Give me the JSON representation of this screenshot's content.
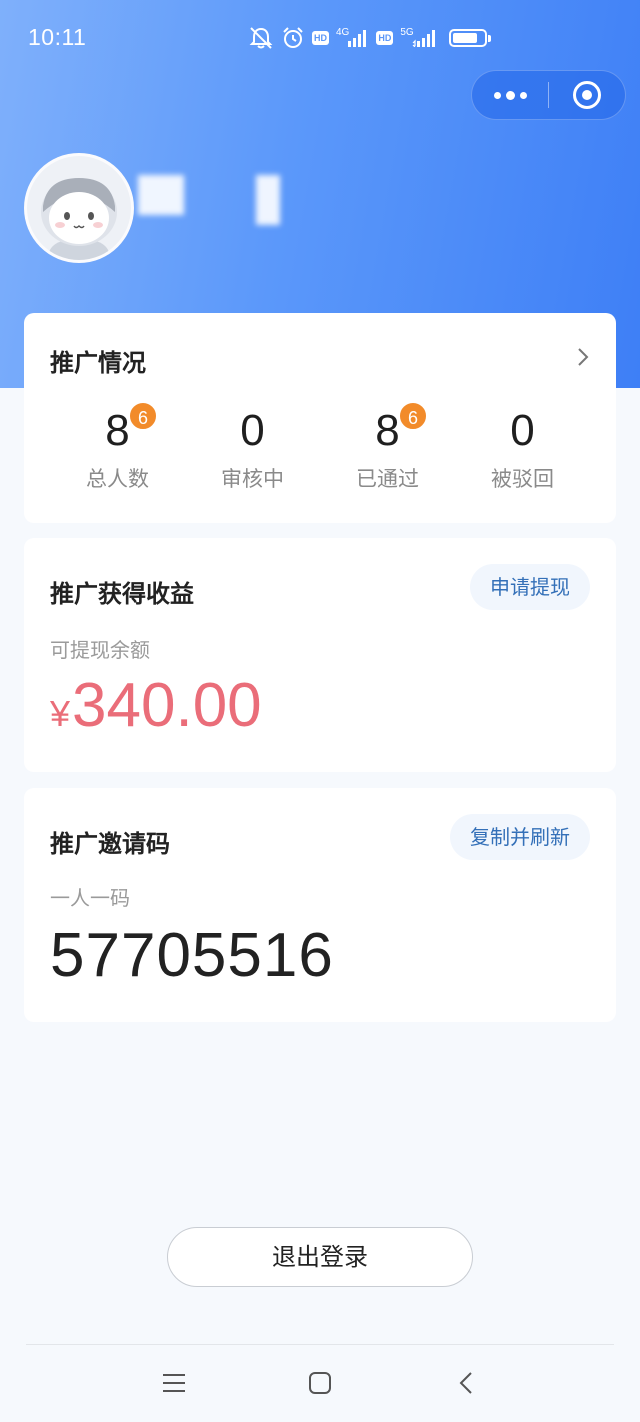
{
  "status_bar": {
    "time": "10:11",
    "network_1": "4G",
    "network_2": "5G",
    "hd_label": "HD",
    "battery_level": 0.8
  },
  "capsule": {
    "more_icon": "more-dots-icon",
    "close_icon": "close-miniprogram-icon"
  },
  "profile": {
    "avatar_icon": "robot-avatar"
  },
  "promotion_overview": {
    "title": "推广情况",
    "stats": [
      {
        "value": "8",
        "label": "总人数",
        "badge": "6"
      },
      {
        "value": "0",
        "label": "审核中",
        "badge": ""
      },
      {
        "value": "8",
        "label": "已通过",
        "badge": "6"
      },
      {
        "value": "0",
        "label": "被驳回",
        "badge": ""
      }
    ]
  },
  "earnings": {
    "title": "推广获得收益",
    "withdraw_button": "申请提现",
    "balance_label": "可提现余额",
    "currency": "¥",
    "amount": "340.00"
  },
  "invite": {
    "title": "推广邀请码",
    "copy_button": "复制并刷新",
    "subtitle": "一人一码",
    "code": "57705516"
  },
  "logout_button": "退出登录",
  "colors": {
    "header_gradient_start": "#7fb0fb",
    "header_gradient_end": "#3e7ff6",
    "badge": "#f28b2a",
    "amount": "#ea6d79",
    "link": "#3470b8"
  }
}
